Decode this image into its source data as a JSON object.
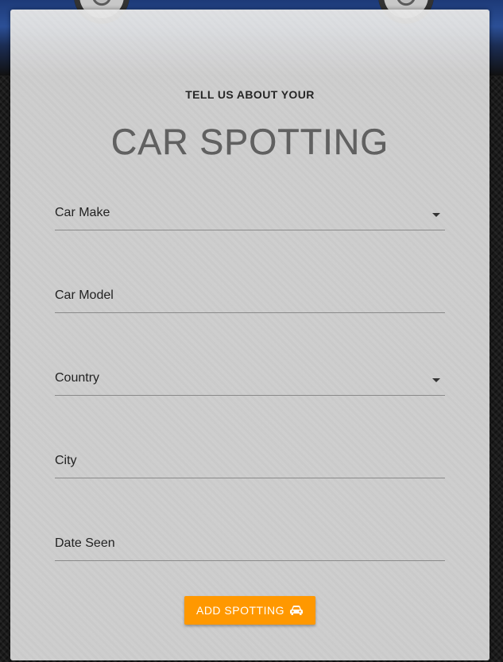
{
  "header": {
    "subtitle": "TELL US ABOUT YOUR",
    "title": "CAR SPOTTING"
  },
  "form": {
    "fields": [
      {
        "label": "Car Make",
        "type": "select"
      },
      {
        "label": "Car Model",
        "type": "text"
      },
      {
        "label": "Country",
        "type": "select"
      },
      {
        "label": "City",
        "type": "text"
      },
      {
        "label": "Date Seen",
        "type": "date"
      }
    ],
    "submit_label": "ADD SPOTTING",
    "submit_icon": "car-icon"
  },
  "colors": {
    "accent": "#ff9800",
    "card": "#dadada",
    "text": "#222222"
  }
}
